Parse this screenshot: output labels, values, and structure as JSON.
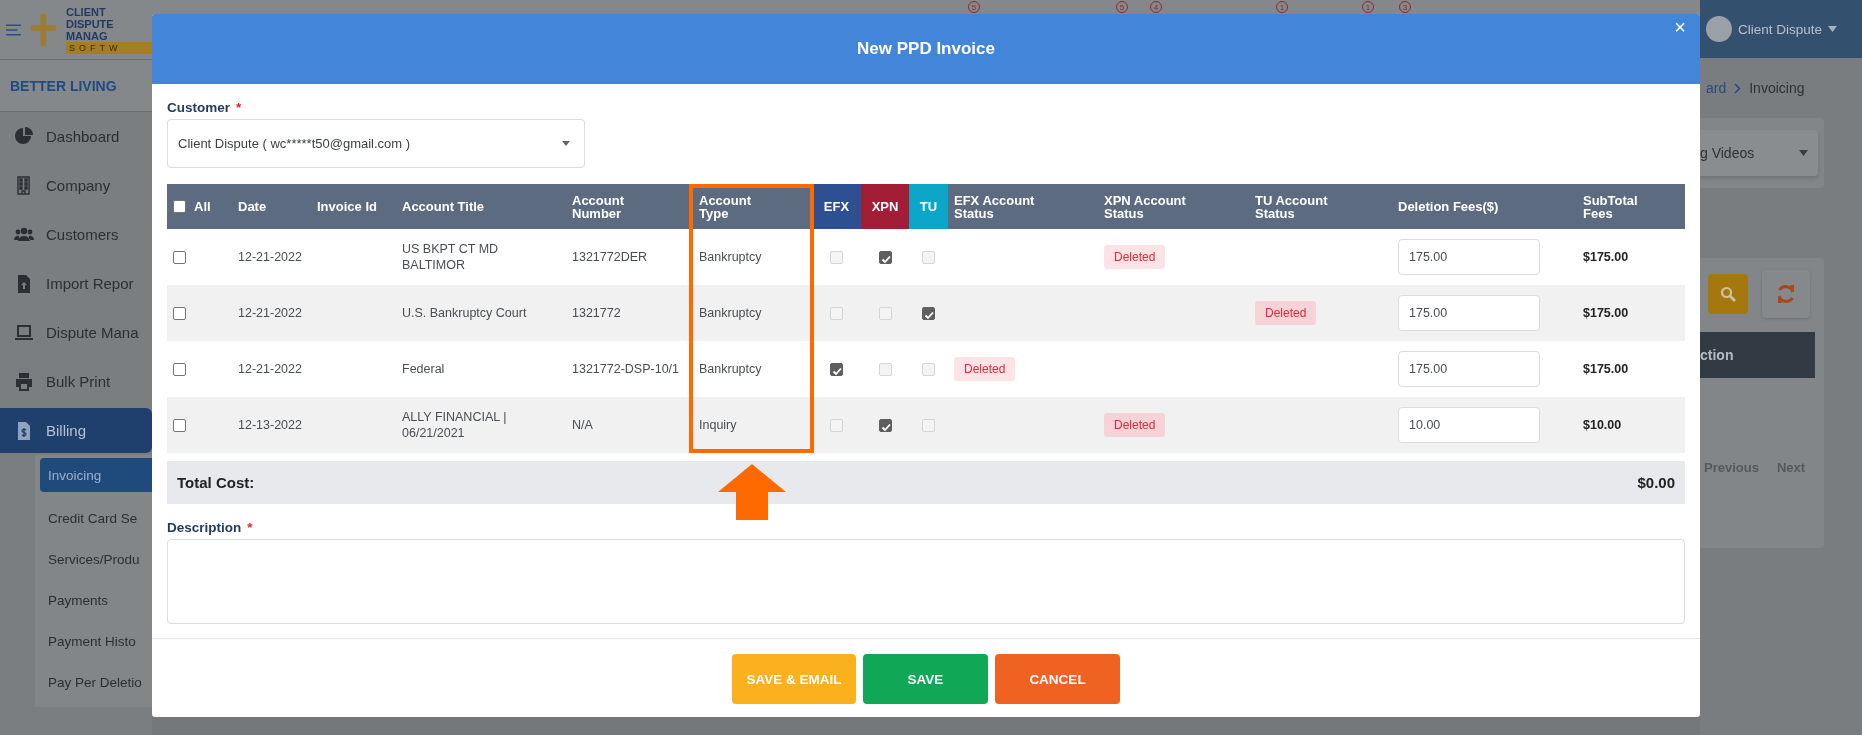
{
  "background": {
    "logo": {
      "line_1": "CLIENT DISPUTE",
      "line_2": "MANAG",
      "line_3": "SOFTW"
    },
    "notification_badges": [
      "5",
      "5",
      "4",
      "1",
      "1",
      "3"
    ],
    "company": "BETTER LIVING",
    "sidebar": {
      "items": [
        {
          "label": "Dashboard",
          "kind": "pie",
          "selected": false
        },
        {
          "label": "Company",
          "kind": "building",
          "selected": false
        },
        {
          "label": "Customers",
          "kind": "users",
          "selected": false
        },
        {
          "label": "Import Repor",
          "kind": "upload",
          "selected": false
        },
        {
          "label": "Dispute Mana",
          "kind": "laptop",
          "selected": false
        },
        {
          "label": "Bulk Print",
          "kind": "printer",
          "selected": false
        },
        {
          "label": "Billing",
          "kind": "invoice",
          "selected": true
        }
      ],
      "submenu": [
        {
          "label": "Invoicing",
          "selected": true
        },
        {
          "label": "Credit Card Se",
          "selected": false
        },
        {
          "label": "Services/Produ",
          "selected": false
        },
        {
          "label": "Payments",
          "selected": false
        },
        {
          "label": "Payment Histo",
          "selected": false
        },
        {
          "label": "Pay Per Deletio",
          "selected": false
        }
      ]
    },
    "user": {
      "name": "Client Dispute"
    },
    "breadcrumb": [
      "ard",
      "Invoicing"
    ],
    "video_dropdown": "g Videos",
    "table_header": "ction",
    "pagination": [
      "Previous",
      "Next"
    ]
  },
  "modal": {
    "title": "New PPD Invoice",
    "close": "×",
    "customer": {
      "label": "Customer",
      "required_mark": "*",
      "value": "Client Dispute ( wc*****t50@gmail.com )"
    },
    "table": {
      "select_all": false,
      "columns": [
        {
          "label": "All",
          "highlighted": false
        },
        {
          "label": "Date",
          "highlighted": false
        },
        {
          "label": "Invoice Id",
          "highlighted": false
        },
        {
          "label": "Account Title",
          "highlighted": false
        },
        {
          "label": "Account Number",
          "highlighted": false
        },
        {
          "label": "Account Type",
          "highlighted": true
        },
        {
          "label": "EFX",
          "highlighted": false,
          "color": "#2f4f93"
        },
        {
          "label": "XPN",
          "highlighted": false,
          "color": "#a31d37"
        },
        {
          "label": "TU",
          "highlighted": false,
          "color": "#0ca6c9"
        },
        {
          "label": "EFX Account Status",
          "highlighted": false
        },
        {
          "label": "XPN Account Status",
          "highlighted": false
        },
        {
          "label": "TU Account Status",
          "highlighted": false
        },
        {
          "label": "Deletion Fees($)",
          "highlighted": false
        },
        {
          "label": "SubTotal Fees",
          "highlighted": false
        }
      ],
      "rows": [
        {
          "selected": false,
          "date": "12-21-2022",
          "account_title": "US BKPT CT MD BALTIMOR",
          "account_number": "1321772DER",
          "account_type": "Bankruptcy",
          "efx": false,
          "xpn": true,
          "tu": false,
          "xpn_status": "Deleted",
          "deletion_fee": "175.00",
          "subtotal": "$175.00"
        },
        {
          "selected": false,
          "date": "12-21-2022",
          "account_title": "U.S. Bankruptcy Court",
          "account_number": "1321772",
          "account_type": "Bankruptcy",
          "efx": false,
          "xpn": false,
          "tu": true,
          "tu_status": "Deleted",
          "deletion_fee": "175.00",
          "subtotal": "$175.00"
        },
        {
          "selected": false,
          "date": "12-21-2022",
          "account_title": "Federal",
          "account_number": "1321772-DSP-10/1",
          "account_type": "Bankruptcy",
          "efx": true,
          "xpn": false,
          "tu": false,
          "efx_status": "Deleted",
          "deletion_fee": "175.00",
          "subtotal": "$175.00"
        },
        {
          "selected": false,
          "date": "12-13-2022",
          "account_title": "ALLY FINANCIAL | 06/21/2021",
          "account_number": "N/A",
          "account_type": "Inquiry",
          "efx": false,
          "xpn": true,
          "tu": false,
          "xpn_status": "Deleted",
          "deletion_fee": "10.00",
          "subtotal": "$10.00"
        }
      ],
      "total_label": "Total Cost:",
      "total": "$0.00"
    },
    "description": {
      "label": "Description",
      "required_mark": "*"
    },
    "buttons": [
      {
        "label": "SAVE & EMAIL",
        "kind": "save-email"
      },
      {
        "label": "SAVE",
        "kind": "save"
      },
      {
        "label": "CANCEL",
        "kind": "cancel"
      }
    ]
  }
}
